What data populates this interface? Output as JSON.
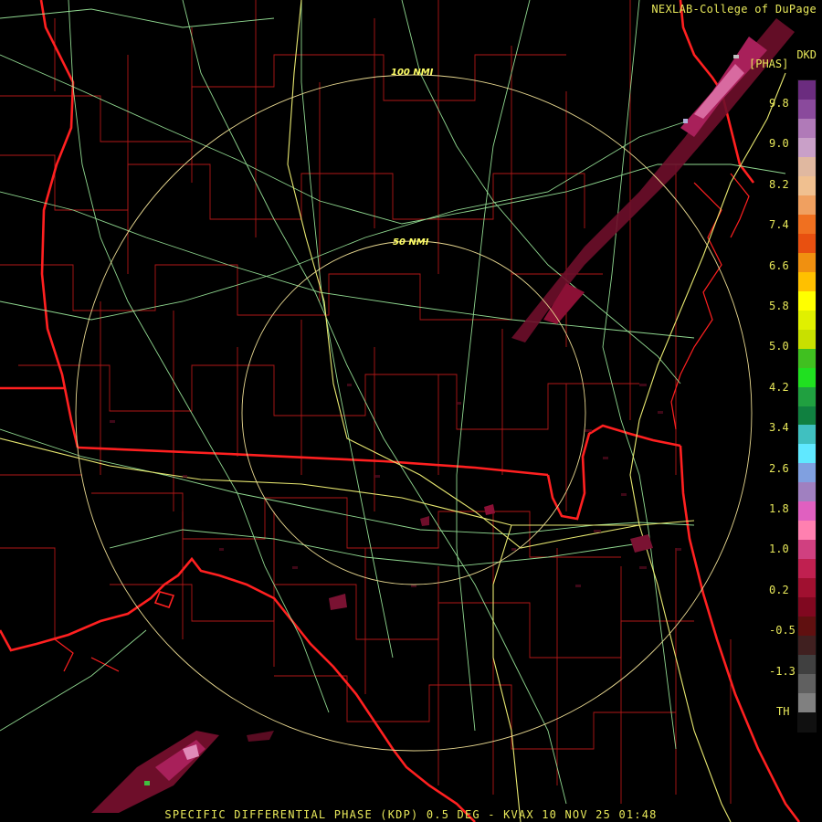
{
  "credit": "NEXLAB-College of DuPage",
  "product_code": "DKD",
  "unit": "[PHAS]",
  "footer": "SPECIFIC DIFFERENTIAL PHASE (KDP) 0.5 DEG - KVAX 10 NOV 25 01:48",
  "range_rings": [
    {
      "label": "50 NMI"
    },
    {
      "label": "100 NMI"
    }
  ],
  "legend_ticks": [
    "9.8",
    "9.0",
    "8.2",
    "7.4",
    "6.6",
    "5.8",
    "5.0",
    "4.2",
    "3.4",
    "2.6",
    "1.8",
    "1.0",
    "0.2",
    "-0.5",
    "-1.3",
    "TH"
  ],
  "colorbar_colors": [
    "#6b2c7f",
    "#8a4a9c",
    "#b07ab8",
    "#c9a0c8",
    "#e0b8a0",
    "#f0c090",
    "#f0a060",
    "#f07020",
    "#e85010",
    "#f09010",
    "#ffc000",
    "#ffff00",
    "#e0f000",
    "#c8e000",
    "#40c020",
    "#20e020",
    "#20a040",
    "#108040",
    "#40c0c0",
    "#60e8ff",
    "#80a0e0",
    "#a080c0",
    "#e060c0",
    "#ff80b0",
    "#d04080",
    "#c02050",
    "#a01030",
    "#800820",
    "#601010",
    "#402020",
    "#404040",
    "#606060",
    "#808080",
    "#101010"
  ],
  "colors": {
    "state_border": "#ff2020",
    "county_border": "#b01818",
    "highway": "#a0f0a0",
    "interstate": "#e8e870",
    "range_ring": "#e8d890",
    "text": "#e8e85a",
    "echo": "#8b1035"
  }
}
